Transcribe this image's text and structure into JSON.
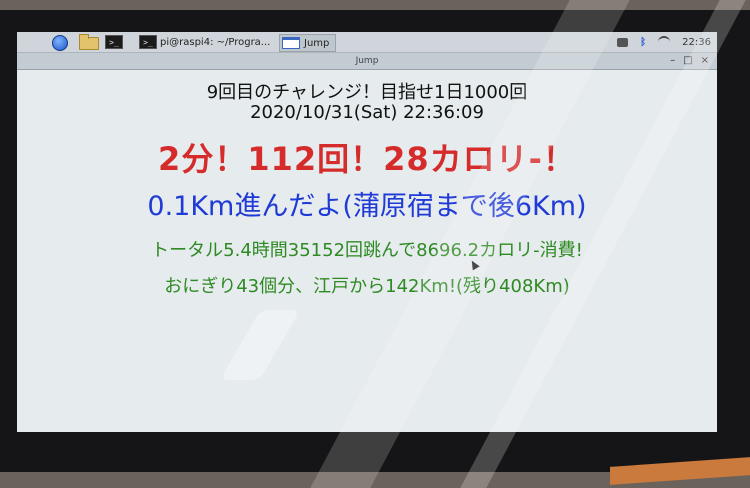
{
  "taskbar": {
    "terminal_glyph": ">_",
    "task_terminal_label": "pi@raspi4: ~/Progra...",
    "task_jump_label": "Jump",
    "clock": "22:36"
  },
  "window": {
    "title": "Jump",
    "minimize": "–",
    "maximize": "□",
    "close": "×"
  },
  "content": {
    "line1": "9回目のチャレンジ！目指せ1日1000回",
    "line2": "2020/10/31(Sat) 22:36:09",
    "line3": "2分！112回！28カロリ-！",
    "line4": "0.1Km進んだよ(蒲原宿まで後6Km)",
    "line5": "トータル5.4時間35152回跳んで8696.2カロリ-消費!",
    "line6": "おにぎり43個分、江戸から142Km!(残り408Km)"
  },
  "colors": {
    "line3": "#d52b2b",
    "line4": "#1f3ad6",
    "line5": "#2e8a22",
    "background": "#e6ebee"
  }
}
